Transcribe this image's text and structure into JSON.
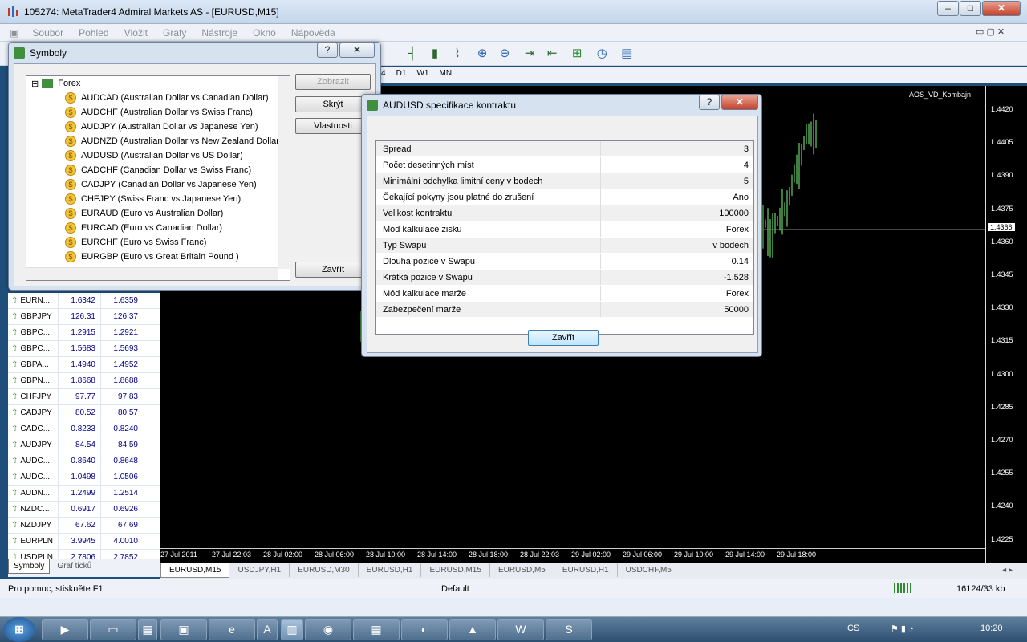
{
  "window": {
    "title": "105274: MetaTrader4 Admiral Markets AS - [EURUSD,M15]"
  },
  "menu": [
    "Soubor",
    "Pohled",
    "Vložit",
    "Grafy",
    "Nástroje",
    "Okno",
    "Nápověda"
  ],
  "periods": [
    "4",
    "D1",
    "W1",
    "MN"
  ],
  "chart": {
    "label": "AOS_VD_Kombajn",
    "current_price": "1.4366",
    "price_levels": [
      "1.4420",
      "1.4405",
      "1.4390",
      "1.4375",
      "1.4360",
      "1.4345",
      "1.4330",
      "1.4315",
      "1.4300",
      "1.4285",
      "1.4270",
      "1.4255",
      "1.4240",
      "1.4225"
    ],
    "time_labels": [
      "27 Jul 2011",
      "27 Jul 22:03",
      "28 Jul 02:00",
      "28 Jul 06:00",
      "28 Jul 10:00",
      "28 Jul 14:00",
      "28 Jul 18:00",
      "28 Jul 22:03",
      "29 Jul 02:00",
      "29 Jul 06:00",
      "29 Jul 10:00",
      "29 Jul 14:00",
      "29 Jul 18:00"
    ]
  },
  "chart_tabs": [
    "EURUSD,M15",
    "USDJPY,H1",
    "EURUSD,M30",
    "EURUSD,H1",
    "EURUSD,M15",
    "EURUSD,M5",
    "EURUSD,H1",
    "USDCHF,M5"
  ],
  "market_watch": {
    "rows": [
      {
        "symbol": "EURN...",
        "bid": "1.6342",
        "ask": "1.6359"
      },
      {
        "symbol": "GBPJPY",
        "bid": "126.31",
        "ask": "126.37"
      },
      {
        "symbol": "GBPC...",
        "bid": "1.2915",
        "ask": "1.2921"
      },
      {
        "symbol": "GBPC...",
        "bid": "1.5683",
        "ask": "1.5693"
      },
      {
        "symbol": "GBPA...",
        "bid": "1.4940",
        "ask": "1.4952"
      },
      {
        "symbol": "GBPN...",
        "bid": "1.8668",
        "ask": "1.8688"
      },
      {
        "symbol": "CHFJPY",
        "bid": "97.77",
        "ask": "97.83"
      },
      {
        "symbol": "CADJPY",
        "bid": "80.52",
        "ask": "80.57"
      },
      {
        "symbol": "CADC...",
        "bid": "0.8233",
        "ask": "0.8240"
      },
      {
        "symbol": "AUDJPY",
        "bid": "84.54",
        "ask": "84.59"
      },
      {
        "symbol": "AUDC...",
        "bid": "0.8640",
        "ask": "0.8648"
      },
      {
        "symbol": "AUDC...",
        "bid": "1.0498",
        "ask": "1.0506"
      },
      {
        "symbol": "AUDN...",
        "bid": "1.2499",
        "ask": "1.2514"
      },
      {
        "symbol": "NZDC...",
        "bid": "0.6917",
        "ask": "0.6926"
      },
      {
        "symbol": "NZDJPY",
        "bid": "67.62",
        "ask": "67.69"
      },
      {
        "symbol": "EURPLN",
        "bid": "3.9945",
        "ask": "4.0010"
      },
      {
        "symbol": "USDPLN",
        "bid": "2.7806",
        "ask": "2.7852"
      }
    ],
    "tabs": [
      "Symboly",
      "Graf ticků"
    ]
  },
  "status": {
    "help": "Pro pomoc, stiskněte F1",
    "profile": "Default",
    "traffic": "16124/33 kb"
  },
  "symbols_dialog": {
    "title": "Symboly",
    "group": "Forex",
    "items": [
      "AUDCAD  (Australian Dollar vs Canadian Dollar)",
      "AUDCHF  (Australian Dollar vs Swiss Franc)",
      "AUDJPY  (Australian Dollar vs Japanese Yen)",
      "AUDNZD  (Australian Dollar vs New Zealand Dollar)",
      "AUDUSD  (Australian Dollar vs US Dollar)",
      "CADCHF  (Canadian Dollar vs Swiss Franc)",
      "CADJPY  (Canadian Dollar vs Japanese Yen)",
      "CHFJPY  (Swiss Franc vs Japanese Yen)",
      "EURAUD  (Euro vs Australian Dollar)",
      "EURCAD  (Euro vs Canadian Dollar)",
      "EURCHF  (Euro vs Swiss Franc)",
      "EURGBP  (Euro vs Great Britain Pound )"
    ],
    "buttons": {
      "show": "Zobrazit",
      "hide": "Skrýt",
      "properties": "Vlastnosti",
      "close": "Zavřít"
    }
  },
  "spec_dialog": {
    "title": "AUDUSD specifikace kontraktu",
    "close": "Zavřít",
    "rows": [
      {
        "k": "Spread",
        "v": "3"
      },
      {
        "k": "Počet desetinných míst",
        "v": "4"
      },
      {
        "k": "Minimální odchylka limitní ceny v bodech",
        "v": "5"
      },
      {
        "k": "Čekající pokyny jsou platné do zrušení",
        "v": "Ano"
      },
      {
        "k": "Velikost kontraktu",
        "v": "100000"
      },
      {
        "k": "Mód kalkulace zisku",
        "v": "Forex"
      },
      {
        "k": "Typ Swapu",
        "v": "v bodech"
      },
      {
        "k": "Dlouhá pozice v Swapu",
        "v": "0.14"
      },
      {
        "k": "Krátká pozice v Swapu",
        "v": "-1.528"
      },
      {
        "k": "Mód kalkulace marže",
        "v": "Forex"
      },
      {
        "k": "Zabezpečení marže",
        "v": "50000"
      }
    ]
  },
  "taskbar": {
    "lang": "CS",
    "clock": "10:20"
  },
  "colors": {
    "candle": "#7cfc7c",
    "chart_bg": "#000000",
    "bid_ask": "#00008b"
  }
}
